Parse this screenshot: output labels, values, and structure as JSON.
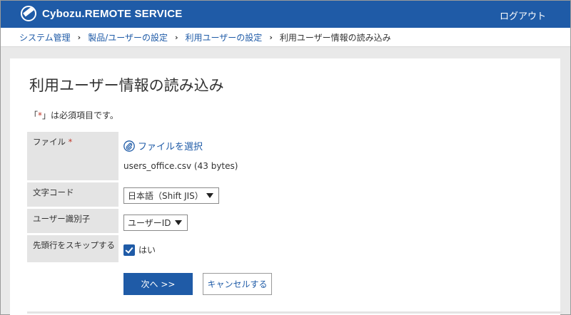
{
  "header": {
    "logo_text": "Cybozu.REMOTE SERVICE",
    "logout_label": "ログアウト"
  },
  "breadcrumb": {
    "items": [
      "システム管理",
      "製品/ユーザーの設定",
      "利用ユーザーの設定"
    ],
    "current": "利用ユーザー情報の読み込み",
    "separator": "›"
  },
  "page": {
    "title": "利用ユーザー情報の読み込み",
    "required_note_open": "「",
    "required_note_star": "*",
    "required_note_close": "」は必須項目です。"
  },
  "form": {
    "file": {
      "label": "ファイル",
      "required_mark": "*",
      "select_link": "ファイルを選択",
      "file_name": "users_office.csv (43 bytes)"
    },
    "encoding": {
      "label": "文字コード",
      "selected": "日本語（Shift JIS）"
    },
    "identifier": {
      "label": "ユーザー識別子",
      "selected": "ユーザーID"
    },
    "skip_header": {
      "label": "先頭行をスキップする",
      "checked": true,
      "option_label": "はい"
    }
  },
  "buttons": {
    "next": "次へ >>",
    "cancel": "キャンセルする"
  },
  "colors": {
    "brand": "#1f5ba7",
    "required": "#c0392b",
    "label_bg": "#e4e4e4"
  }
}
